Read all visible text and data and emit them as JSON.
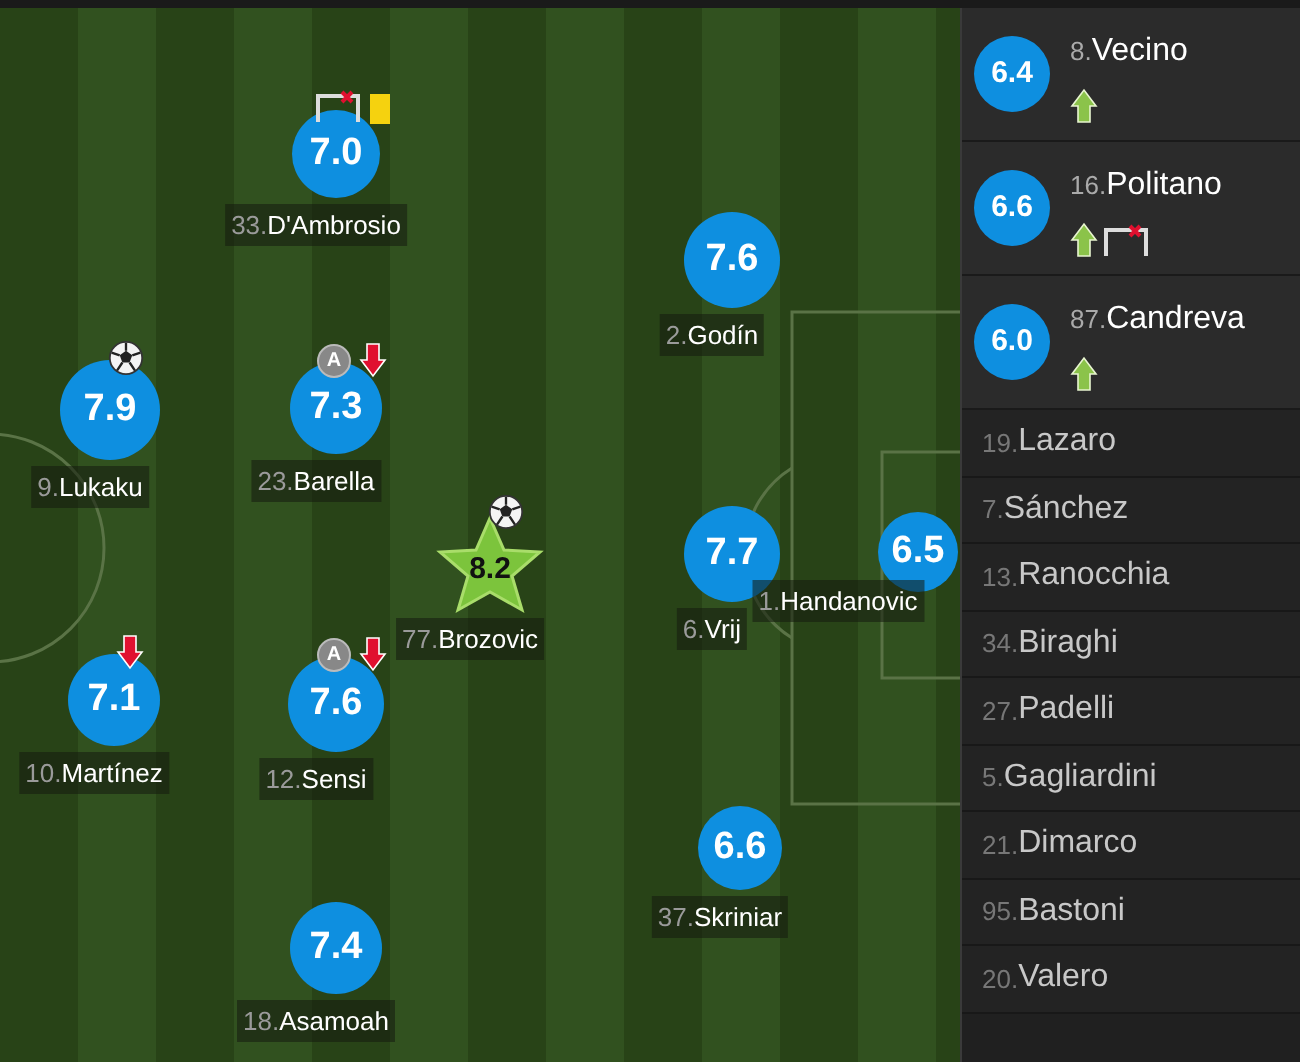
{
  "pitch": {
    "players": [
      {
        "number": "33.",
        "name": "D'Ambrosio",
        "rating": "7.0",
        "motm": false,
        "events": [
          {
            "kind": "goal_error"
          },
          {
            "kind": "yellow_card"
          }
        ]
      },
      {
        "number": "2.",
        "name": "Godín",
        "rating": "7.6",
        "motm": false
      },
      {
        "number": "9.",
        "name": "Lukaku",
        "rating": "7.9",
        "motm": false,
        "events": [
          {
            "kind": "goal"
          }
        ]
      },
      {
        "number": "23.",
        "name": "Barella",
        "rating": "7.3",
        "motm": false,
        "events": [
          {
            "kind": "assist",
            "label": "A"
          },
          {
            "kind": "sub_off"
          }
        ]
      },
      {
        "number": "77.",
        "name": "Brozovic",
        "rating": "8.2",
        "motm": true,
        "events": [
          {
            "kind": "goal"
          }
        ]
      },
      {
        "number": "6.",
        "name": "Vrij",
        "rating": "7.7",
        "motm": false
      },
      {
        "number": "1.",
        "name": "Handanovic",
        "rating": "6.5",
        "motm": false
      },
      {
        "number": "10.",
        "name": "Martínez",
        "rating": "7.1",
        "motm": false,
        "events": [
          {
            "kind": "sub_off"
          }
        ]
      },
      {
        "number": "12.",
        "name": "Sensi",
        "rating": "7.6",
        "motm": false,
        "events": [
          {
            "kind": "assist",
            "label": "A"
          },
          {
            "kind": "sub_off"
          }
        ]
      },
      {
        "number": "37.",
        "name": "Skriniar",
        "rating": "6.6",
        "motm": false
      },
      {
        "number": "18.",
        "name": "Asamoah",
        "rating": "7.4",
        "motm": false
      }
    ]
  },
  "bench": {
    "substitutes": [
      {
        "number": "8.",
        "name": "Vecino",
        "rating": "6.4",
        "events": [
          {
            "kind": "sub_on"
          }
        ]
      },
      {
        "number": "16.",
        "name": "Politano",
        "rating": "6.6",
        "events": [
          {
            "kind": "sub_on"
          },
          {
            "kind": "goal_error"
          }
        ]
      },
      {
        "number": "87.",
        "name": "Candreva",
        "rating": "6.0",
        "events": [
          {
            "kind": "sub_on"
          }
        ]
      }
    ],
    "unused": [
      {
        "number": "19.",
        "name": "Lazaro"
      },
      {
        "number": "7.",
        "name": "Sánchez"
      },
      {
        "number": "13.",
        "name": "Ranocchia"
      },
      {
        "number": "34.",
        "name": "Biraghi"
      },
      {
        "number": "27.",
        "name": "Padelli"
      },
      {
        "number": "5.",
        "name": "Gagliardini"
      },
      {
        "number": "21.",
        "name": "Dimarco"
      },
      {
        "number": "95.",
        "name": "Bastoni"
      },
      {
        "number": "20.",
        "name": "Valero"
      }
    ]
  }
}
